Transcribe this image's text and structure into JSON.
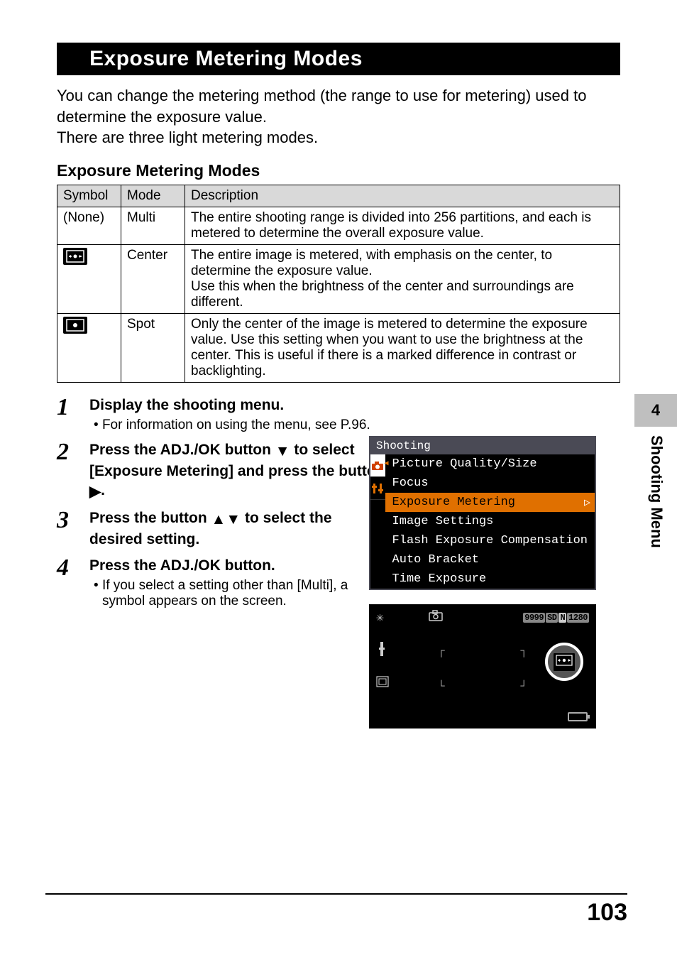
{
  "title": "Exposure Metering Modes",
  "intro": "You can change the metering method (the range to use for metering) used to determine the exposure value.\nThere are three light metering modes.",
  "table_heading": "Exposure Metering Modes",
  "table": {
    "headers": {
      "symbol": "Symbol",
      "mode": "Mode",
      "description": "Description"
    },
    "rows": [
      {
        "symbol": "(None)",
        "mode": "Multi",
        "description": "The entire shooting range is divided into 256 partitions, and each is metered to determine the overall exposure value."
      },
      {
        "symbol": "center-icon",
        "mode": "Center",
        "description": "The entire image is metered, with emphasis on the center, to determine the exposure value.\nUse this when the brightness of the center and surroundings are different."
      },
      {
        "symbol": "spot-icon",
        "mode": "Spot",
        "description": "Only the center of the image is metered to determine the exposure value. Use this setting when you want to use the brightness at the center. This is useful if there is a marked difference in contrast or backlighting."
      }
    ]
  },
  "steps": [
    {
      "num": "1",
      "head": "Display the shooting menu.",
      "sub": "For information on using the menu, see P.96."
    },
    {
      "num": "2",
      "head": "Press the ADJ./OK button ▼ to select [Exposure Metering] and press the button ▶."
    },
    {
      "num": "3",
      "head": "Press the button ▲▼ to select the desired setting."
    },
    {
      "num": "4",
      "head": "Press the ADJ./OK button.",
      "sub": "If you select a setting other than [Multi], a symbol appears on the screen."
    }
  ],
  "lcd": {
    "title": "Shooting",
    "items": [
      "Picture Quality/Size",
      "Focus",
      "Exposure Metering",
      "Image Settings",
      "Flash Exposure Compensation",
      "Auto Bracket",
      "Time Exposure"
    ],
    "selected_index": 2
  },
  "preview": {
    "counter_main": "9999",
    "counter_sd": "SD",
    "counter_n": "N",
    "counter_res": "1280"
  },
  "side": {
    "chapter_num": "4",
    "chapter_label": "Shooting Menu"
  },
  "page_number": "103"
}
